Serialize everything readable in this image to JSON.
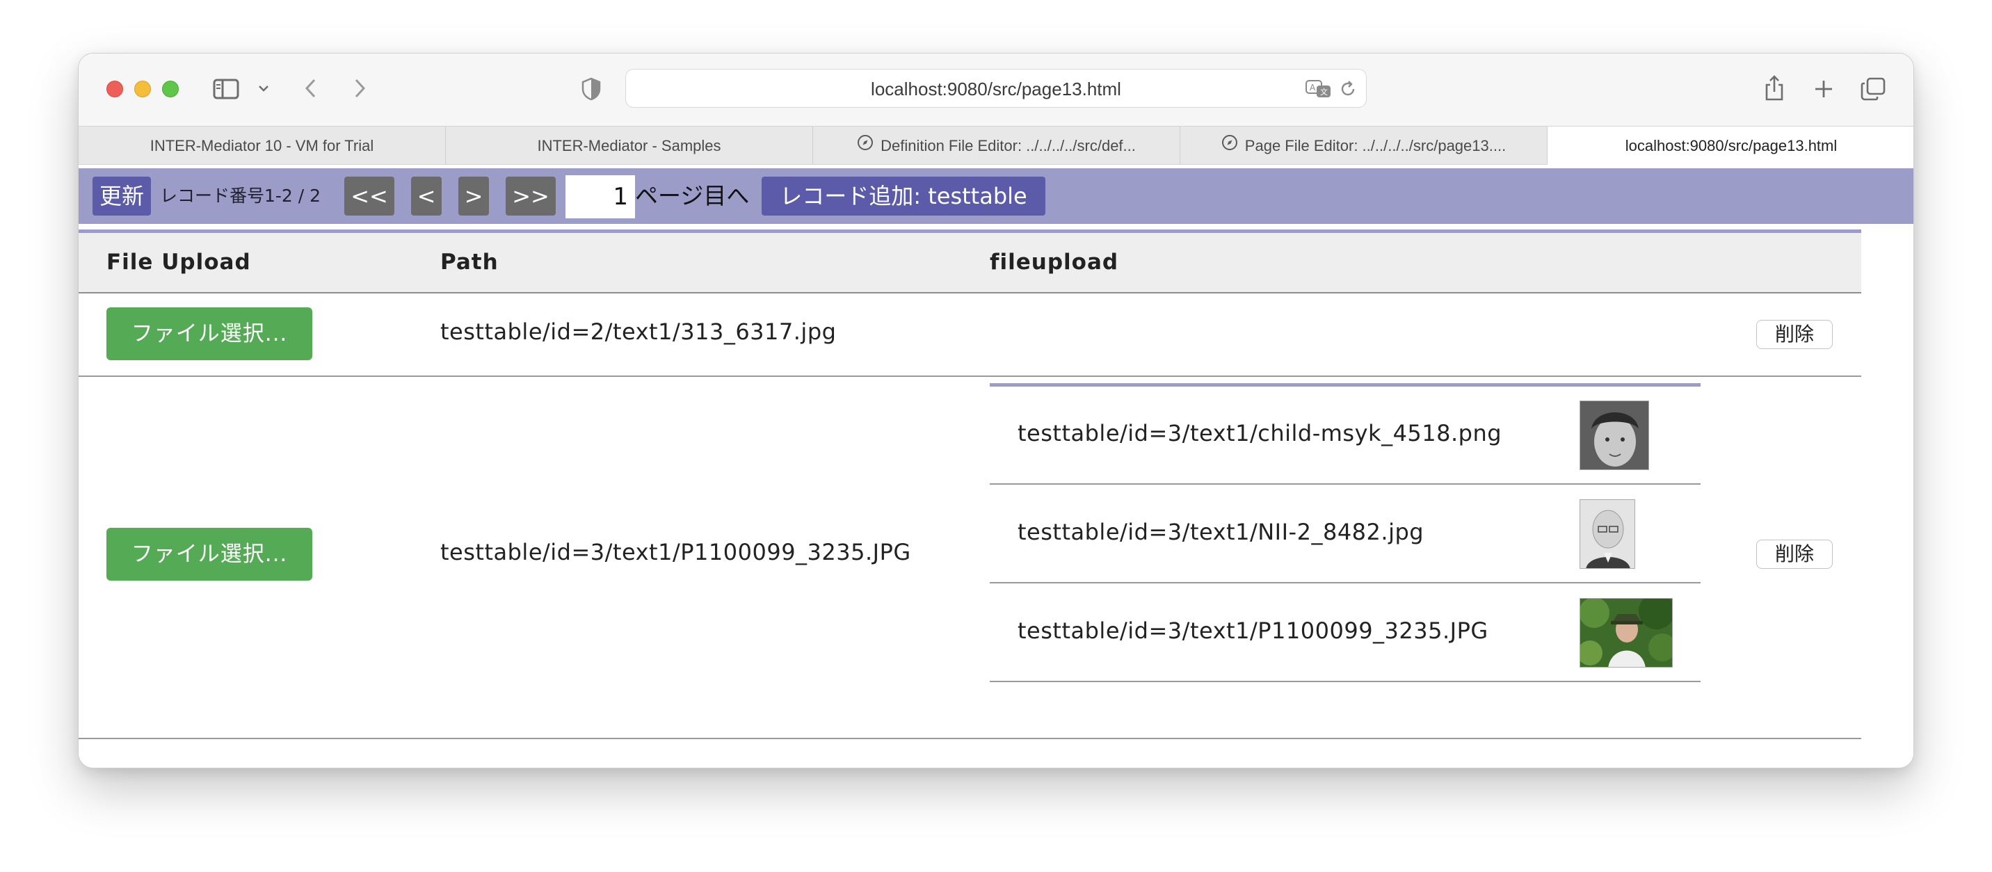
{
  "browser": {
    "url": "localhost:9080/src/page13.html",
    "tabs": [
      {
        "label": "INTER-Mediator 10 - VM for Trial",
        "icon": ""
      },
      {
        "label": "INTER-Mediator - Samples",
        "icon": ""
      },
      {
        "label": "Definition File Editor: ../../../../src/def...",
        "icon": "compass-icon"
      },
      {
        "label": "Page File Editor: ../../../../src/page13....",
        "icon": "compass-icon"
      },
      {
        "label": "localhost:9080/src/page13.html",
        "icon": ""
      }
    ]
  },
  "navigation": {
    "refresh": "更新",
    "record_info": "レコード番号1-2 / 2",
    "first": "<<",
    "prev": "<",
    "next": ">",
    "last": ">>",
    "page_value": "1",
    "page_label": "ページ目へ",
    "add_record": "レコード追加: testtable"
  },
  "table": {
    "headers": [
      "File Upload",
      "Path",
      "fileupload"
    ],
    "rows": [
      {
        "button": "ファイル選択...",
        "path": "testtable/id=2/text1/313_6317.jpg",
        "delete": "削除",
        "files": []
      },
      {
        "button": "ファイル選択...",
        "path": "testtable/id=3/text1/P1100099_3235.JPG",
        "delete": "削除",
        "files": [
          {
            "path": "testtable/id=3/text1/child-msyk_4518.png"
          },
          {
            "path": "testtable/id=3/text1/NII-2_8482.jpg"
          },
          {
            "path": "testtable/id=3/text1/P1100099_3235.JPG"
          }
        ]
      }
    ]
  },
  "colors": {
    "navbar": "#9c9cc9",
    "nav_button": "#5b5ba9",
    "pager_button": "#6b6b6b",
    "file_button": "#55ab55"
  }
}
